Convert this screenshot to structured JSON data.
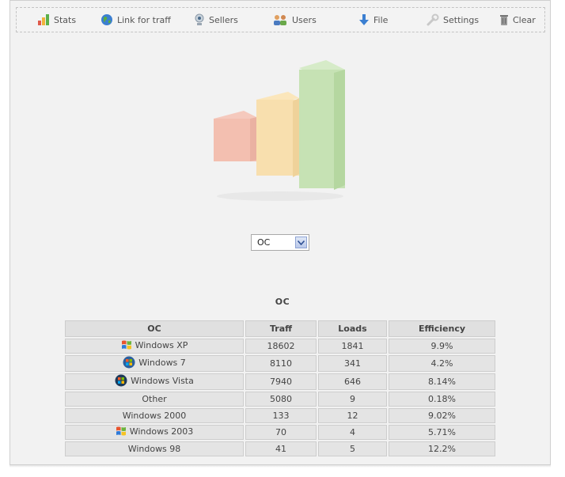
{
  "menu": {
    "items": [
      {
        "key": "stats",
        "label": "Stats",
        "icon": "bar-chart-icon"
      },
      {
        "key": "link",
        "label": "Link for traff",
        "icon": "globe-icon"
      },
      {
        "key": "sellers",
        "label": "Sellers",
        "icon": "webcam-icon"
      },
      {
        "key": "users",
        "label": "Users",
        "icon": "users-icon"
      },
      {
        "key": "file",
        "label": "File",
        "icon": "download-arrow-icon"
      },
      {
        "key": "settings",
        "label": "Settings",
        "icon": "wrench-icon"
      },
      {
        "key": "clear",
        "label": "Clear",
        "icon": "trash-can-icon"
      }
    ]
  },
  "logo": {
    "icon": "bar-chart-logo-icon"
  },
  "filter": {
    "selected": "OC"
  },
  "table": {
    "title": "OC",
    "columns": [
      "OC",
      "Traff",
      "Loads",
      "Efficiency"
    ],
    "rows": [
      {
        "os": "Windows XP",
        "icon": "windows-xp-flag-icon",
        "traff": "18602",
        "loads": "1841",
        "eff": "9.9%"
      },
      {
        "os": "Windows 7",
        "icon": "windows-7-orb-icon",
        "traff": "8110",
        "loads": "341",
        "eff": "4.2%"
      },
      {
        "os": "Windows Vista",
        "icon": "windows-vista-orb-icon",
        "traff": "7940",
        "loads": "646",
        "eff": "8.14%"
      },
      {
        "os": "Other",
        "icon": "",
        "traff": "5080",
        "loads": "9",
        "eff": "0.18%"
      },
      {
        "os": "Windows 2000",
        "icon": "",
        "traff": "133",
        "loads": "12",
        "eff": "9.02%"
      },
      {
        "os": "Windows 2003",
        "icon": "windows-2003-flag-icon",
        "traff": "70",
        "loads": "4",
        "eff": "5.71%"
      },
      {
        "os": "Windows 98",
        "icon": "",
        "traff": "41",
        "loads": "5",
        "eff": "12.2%"
      }
    ]
  },
  "colors": {
    "panel": "#f2f2f2",
    "cell": "#e4e4e4",
    "border": "#cdcdcd",
    "text": "#444444"
  }
}
